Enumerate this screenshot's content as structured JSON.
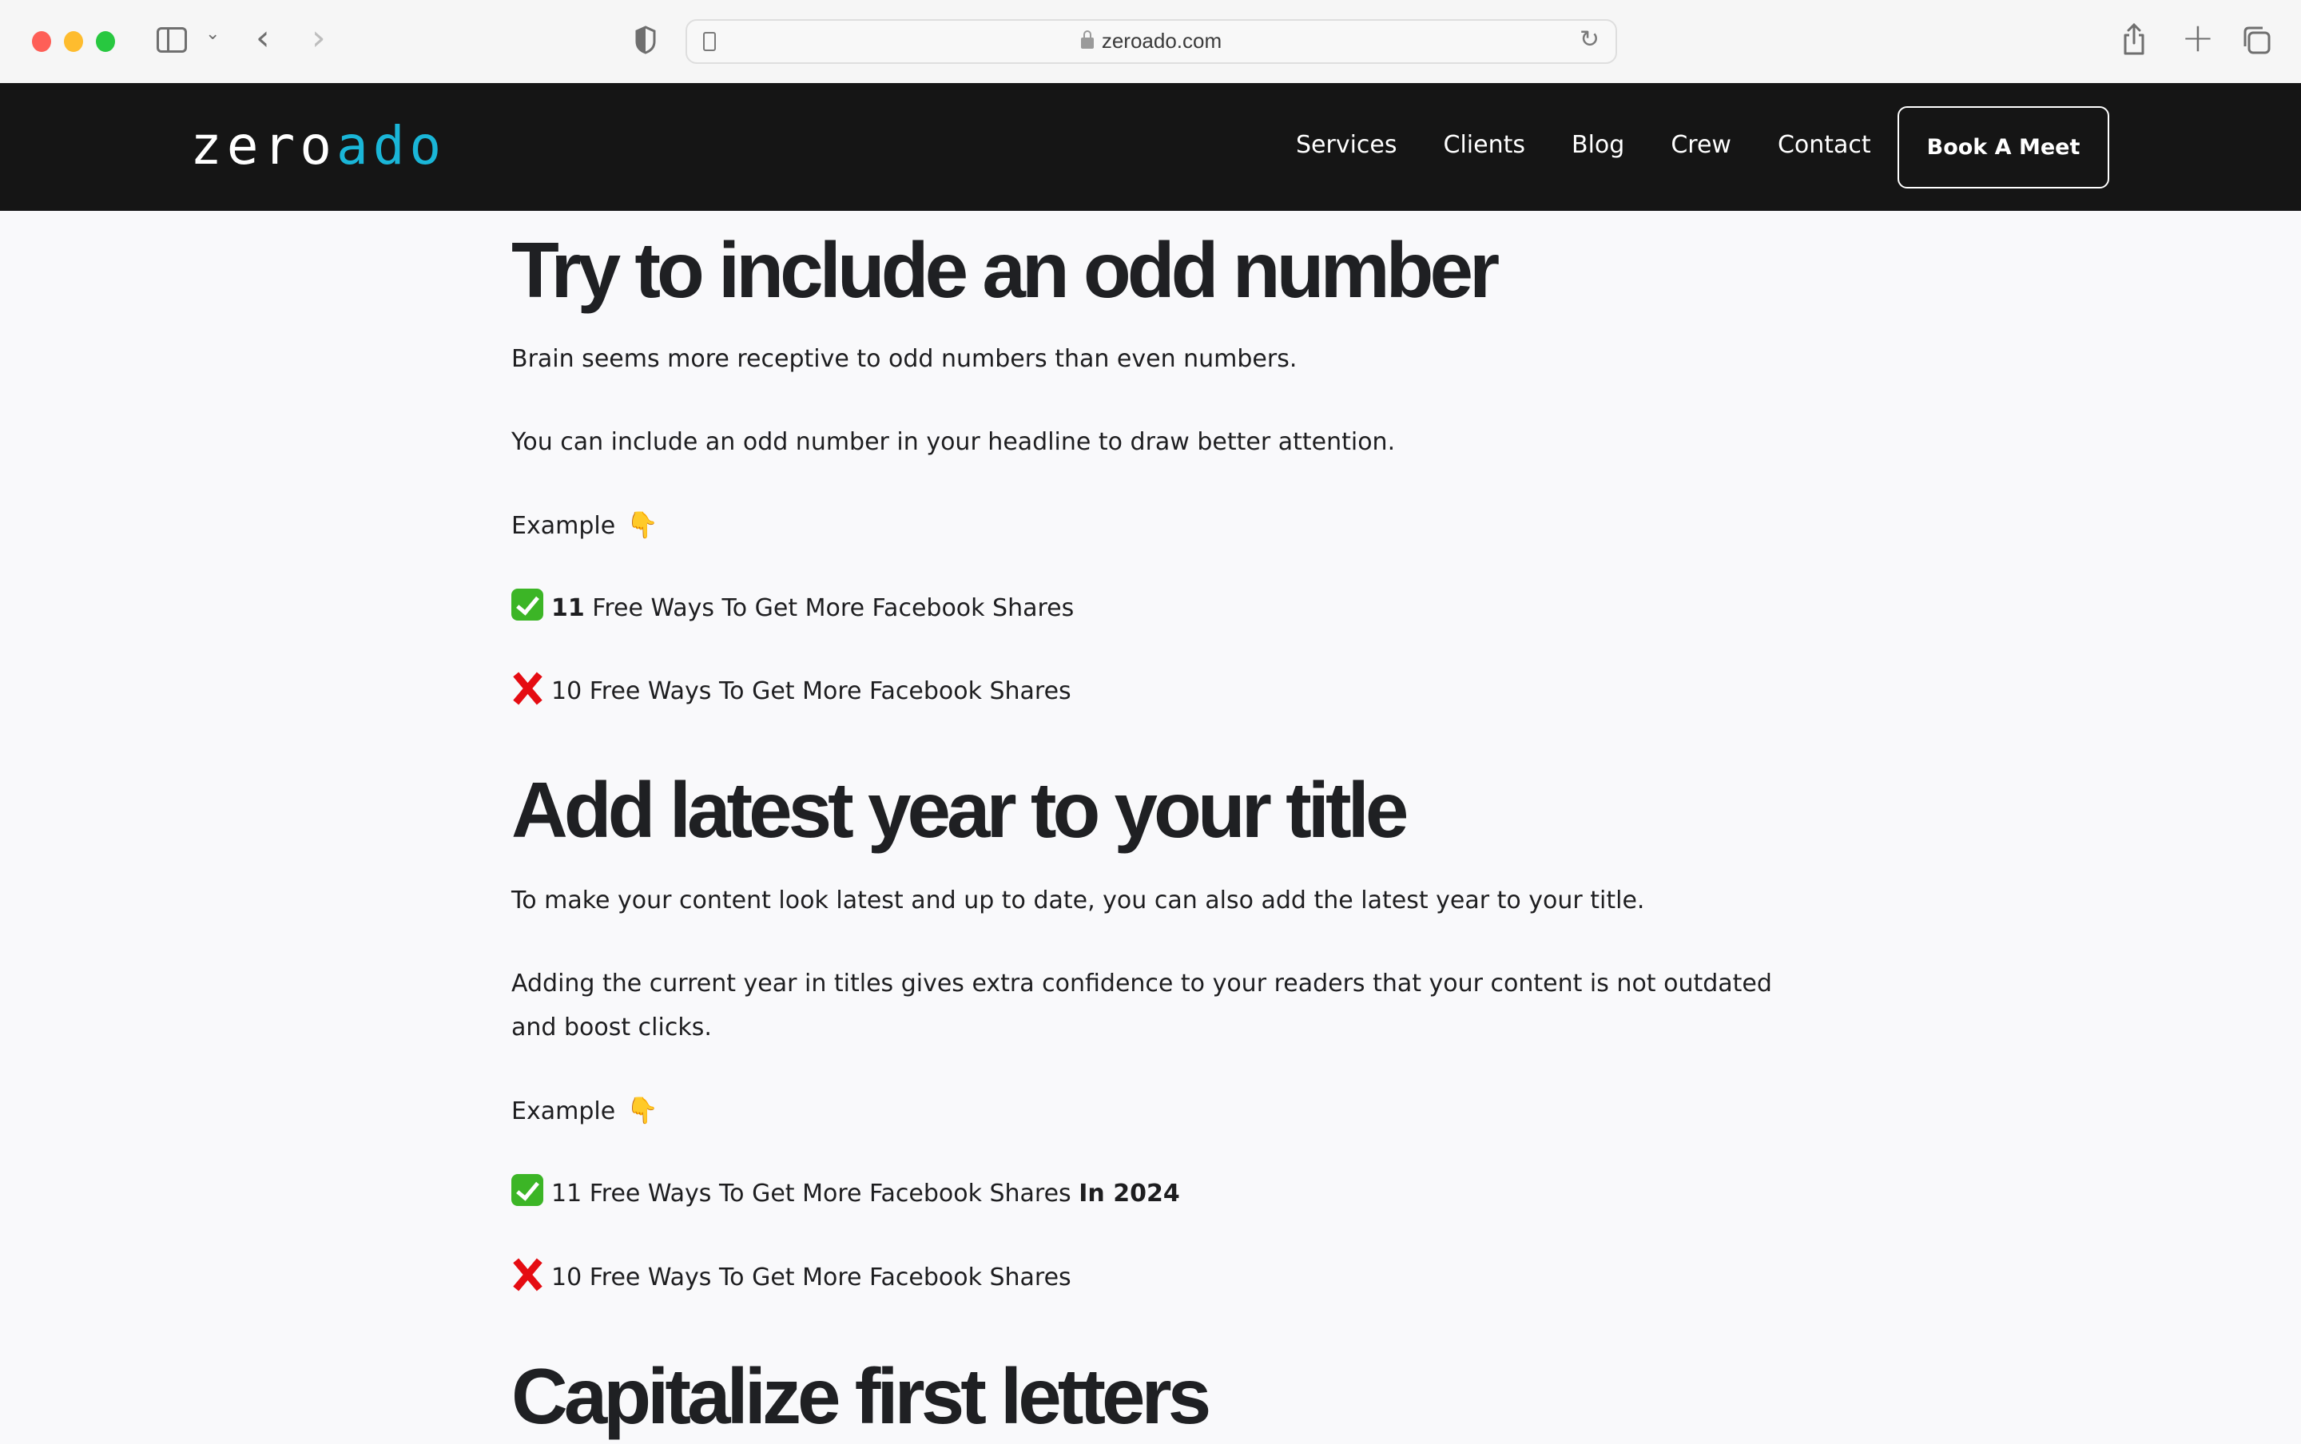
{
  "browser": {
    "url": "zeroado.com",
    "icons": [
      "close-window",
      "minimize-window",
      "maximize-window",
      "sidebar-toggle",
      "chevron-down",
      "back",
      "forward",
      "privacy-shield",
      "reader-view",
      "lock",
      "reload",
      "share",
      "new-tab",
      "tab-overview"
    ]
  },
  "site": {
    "logo": {
      "part1": "zero",
      "part2": "ado",
      "accent": "#1ab6d8"
    },
    "nav": [
      {
        "label": "Services"
      },
      {
        "label": "Clients"
      },
      {
        "label": "Blog"
      },
      {
        "label": "Crew"
      },
      {
        "label": "Contact"
      }
    ],
    "cta": "Book A Meet"
  },
  "article": {
    "section1": {
      "heading": "Try to include an odd number",
      "p1": "Brain seems more receptive to odd numbers than even numbers.",
      "p2": "You can include an odd number in your headline to draw better attention.",
      "example_label": "Example",
      "example_emoji": "👇",
      "good": {
        "bold": "11",
        "text": " Free Ways To Get More Facebook Shares"
      },
      "bad": {
        "text": "10 Free Ways To Get More Facebook Shares"
      }
    },
    "section2": {
      "heading": "Add latest year to your title",
      "p1": "To make your content look latest and up to date, you can also add the latest year to your title.",
      "p2": "Adding the current year in titles gives extra confidence to your readers that your content is not outdated and boost clicks.",
      "example_label": "Example",
      "example_emoji": "👇",
      "good": {
        "text": "11 Free Ways To Get More Facebook Shares ",
        "bold": "In 2024"
      },
      "bad": {
        "text": "10 Free Ways To Get More Facebook Shares"
      }
    },
    "section3": {
      "heading": "Capitalize first letters"
    }
  }
}
